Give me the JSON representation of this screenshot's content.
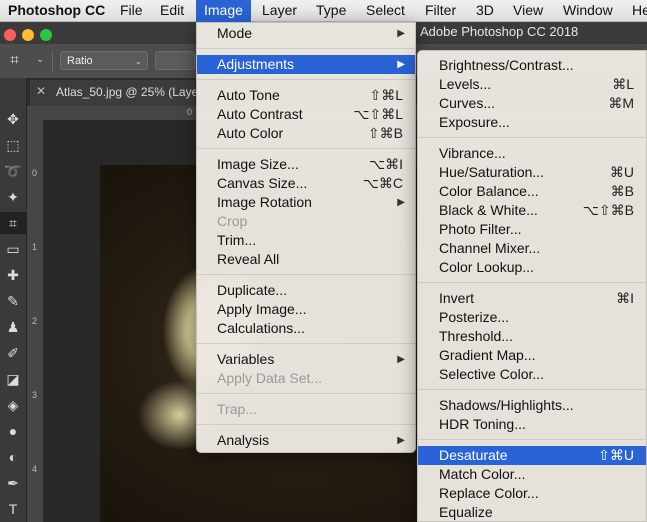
{
  "menubar": {
    "app": "Photoshop CC",
    "file": "File",
    "edit": "Edit",
    "image": "Image",
    "layer": "Layer",
    "type": "Type",
    "select": "Select",
    "filter": "Filter",
    "threed": "3D",
    "view": "View",
    "window": "Window",
    "help": "He"
  },
  "app_title": "Adobe Photoshop CC 2018",
  "options": {
    "ratio_select": "Ratio"
  },
  "document": {
    "tab_label": "Atlas_50.jpg @ 25% (Layer"
  },
  "ruler": {
    "top_0": "0",
    "left": [
      "0",
      "1",
      "2",
      "3",
      "4"
    ]
  },
  "image_menu": {
    "mode": "Mode",
    "adjustments": "Adjustments",
    "auto_tone": "Auto Tone",
    "auto_tone_sc": "⇧⌘L",
    "auto_contrast": "Auto Contrast",
    "auto_contrast_sc": "⌥⇧⌘L",
    "auto_color": "Auto Color",
    "auto_color_sc": "⇧⌘B",
    "image_size": "Image Size...",
    "image_size_sc": "⌥⌘I",
    "canvas_size": "Canvas Size...",
    "canvas_size_sc": "⌥⌘C",
    "image_rotation": "Image Rotation",
    "crop": "Crop",
    "trim": "Trim...",
    "reveal_all": "Reveal All",
    "duplicate": "Duplicate...",
    "apply_image": "Apply Image...",
    "calculations": "Calculations...",
    "variables": "Variables",
    "apply_data_set": "Apply Data Set...",
    "trap": "Trap...",
    "analysis": "Analysis"
  },
  "adjustments_menu": {
    "brightness_contrast": "Brightness/Contrast...",
    "levels": "Levels...",
    "levels_sc": "⌘L",
    "curves": "Curves...",
    "curves_sc": "⌘M",
    "exposure": "Exposure...",
    "vibrance": "Vibrance...",
    "hue_saturation": "Hue/Saturation...",
    "hue_saturation_sc": "⌘U",
    "color_balance": "Color Balance...",
    "color_balance_sc": "⌘B",
    "black_white": "Black & White...",
    "black_white_sc": "⌥⇧⌘B",
    "photo_filter": "Photo Filter...",
    "channel_mixer": "Channel Mixer...",
    "color_lookup": "Color Lookup...",
    "invert": "Invert",
    "invert_sc": "⌘I",
    "posterize": "Posterize...",
    "threshold": "Threshold...",
    "gradient_map": "Gradient Map...",
    "selective_color": "Selective Color...",
    "shadows_highlights": "Shadows/Highlights...",
    "hdr_toning": "HDR Toning...",
    "desaturate": "Desaturate",
    "desaturate_sc": "⇧⌘U",
    "match_color": "Match Color...",
    "replace_color": "Replace Color...",
    "equalize": "Equalize"
  }
}
